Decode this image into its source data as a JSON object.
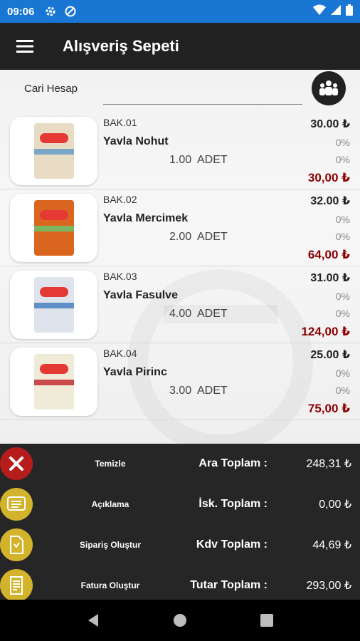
{
  "status": {
    "time": "09:06"
  },
  "header": {
    "title": "Alışveriş Sepeti"
  },
  "cari": {
    "label": "Cari Hesap"
  },
  "items": [
    {
      "code": "BAK.01",
      "name": "Yavla Nohut",
      "qty": "1.00",
      "unit": "ADET",
      "price": "30.00 ₺",
      "disc1": "0%",
      "disc2": "0%",
      "total": "30,00 ₺",
      "bag_color": "#e8ddc4",
      "band_color": "#7aa6c9"
    },
    {
      "code": "BAK.02",
      "name": "Yavla Mercimek",
      "qty": "2.00",
      "unit": "ADET",
      "price": "32.00 ₺",
      "disc1": "0%",
      "disc2": "0%",
      "total": "64,00 ₺",
      "bag_color": "#d9651f",
      "band_color": "#7bb661"
    },
    {
      "code": "BAK.03",
      "name": "Yavla Fasulve",
      "qty": "4.00",
      "unit": "ADET",
      "price": "31.00 ₺",
      "disc1": "0%",
      "disc2": "0%",
      "total": "124,00 ₺",
      "bag_color": "#dfe4ec",
      "band_color": "#5f8fc4"
    },
    {
      "code": "BAK.04",
      "name": "Yavla Pirinc",
      "qty": "3.00",
      "unit": "ADET",
      "price": "25.00 ₺",
      "disc1": "0%",
      "disc2": "0%",
      "total": "75,00 ₺",
      "bag_color": "#f0ead8",
      "band_color": "#c94a4a"
    }
  ],
  "actions": [
    {
      "label": "Temizle",
      "icon": "close-icon",
      "color": "#b71c1c"
    },
    {
      "label": "Açıklama",
      "icon": "note-icon",
      "color": "#d4b32c"
    },
    {
      "label": "Sipariş Oluştur",
      "icon": "order-icon",
      "color": "#d4b32c"
    },
    {
      "label": "Fatura Oluştur",
      "icon": "invoice-icon",
      "color": "#d4b32c"
    }
  ],
  "summary": [
    {
      "label": "Ara Toplam :",
      "value": "248,31 ₺"
    },
    {
      "label": "İsk. Toplam :",
      "value": "0,00 ₺"
    },
    {
      "label": "Kdv Toplam :",
      "value": "44,69 ₺"
    },
    {
      "label": "Tutar Toplam :",
      "value": "293,00 ₺"
    }
  ],
  "colors": {
    "status_bar": "#1976d2",
    "app_bar": "#212121",
    "total_red": "#8b0000",
    "panel": "#262626"
  }
}
